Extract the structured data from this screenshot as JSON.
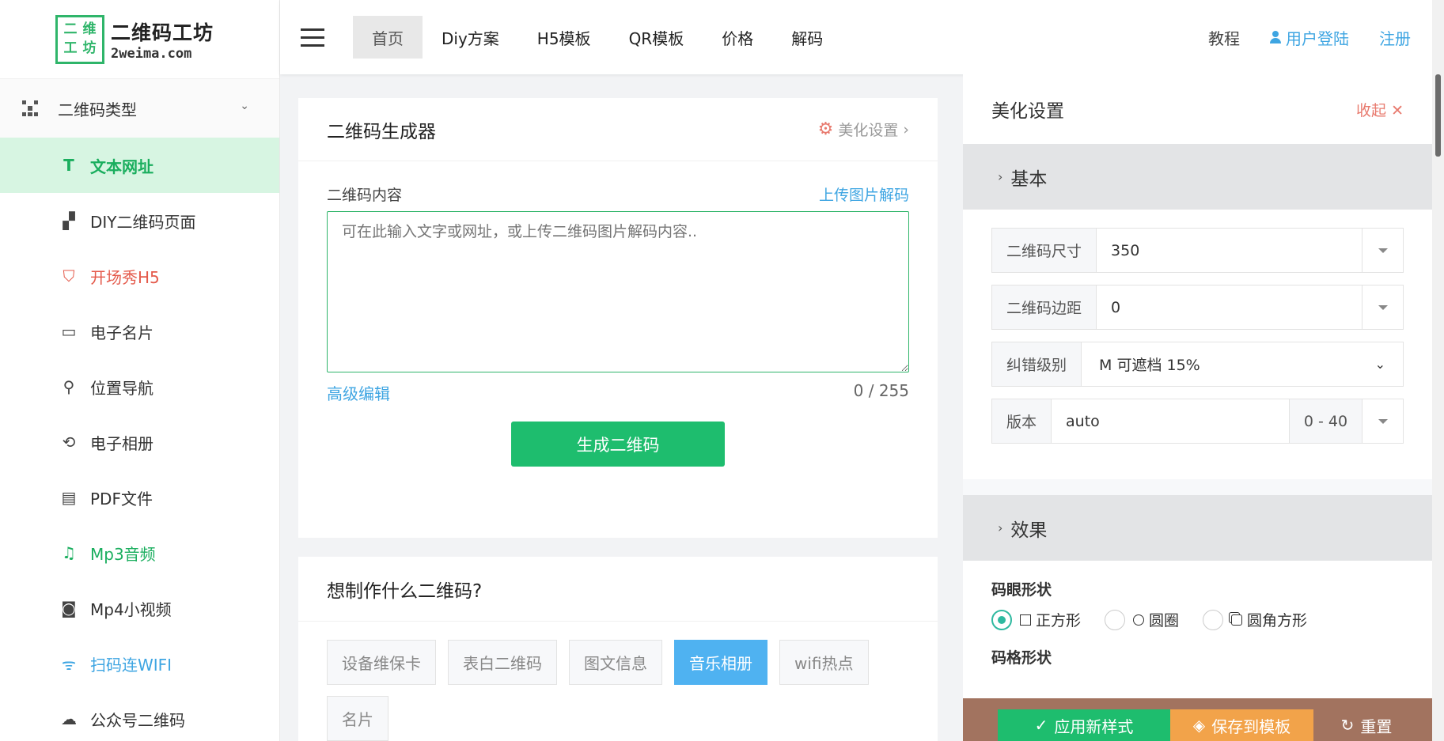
{
  "logo": {
    "cn": "二维码工坊",
    "en": "2weima.com",
    "box_chars": [
      "二",
      "维",
      "工",
      "坊"
    ]
  },
  "sidebar": {
    "group_label": "二维码类型",
    "items": [
      {
        "label": "文本网址",
        "icon": "text-icon",
        "glyph": "T"
      },
      {
        "label": "DIY二维码页面",
        "icon": "layout-icon",
        "glyph": "▞"
      },
      {
        "label": "开场秀H5",
        "icon": "html5-icon",
        "glyph": "⛉"
      },
      {
        "label": "电子名片",
        "icon": "id-card-icon",
        "glyph": "▭"
      },
      {
        "label": "位置导航",
        "icon": "location-icon",
        "glyph": "⚲"
      },
      {
        "label": "电子相册",
        "icon": "refresh-icon",
        "glyph": "⟲"
      },
      {
        "label": "PDF文件",
        "icon": "pdf-icon",
        "glyph": "▤"
      },
      {
        "label": "Mp3音频",
        "icon": "music-icon",
        "glyph": "♫"
      },
      {
        "label": "Mp4小视频",
        "icon": "camera-icon",
        "glyph": "◙"
      },
      {
        "label": "扫码连WIFI",
        "icon": "wifi-icon",
        "glyph": "ᯤ"
      },
      {
        "label": "公众号二维码",
        "icon": "wechat-icon",
        "glyph": "☁"
      }
    ]
  },
  "topnav": {
    "items": [
      "首页",
      "Diy方案",
      "H5模板",
      "QR模板",
      "价格",
      "解码"
    ],
    "tutorial": "教程",
    "login": "用户登陆",
    "register": "注册"
  },
  "generator": {
    "title": "二维码生成器",
    "beautify_link": "美化设置",
    "content_label": "二维码内容",
    "upload_link": "上传图片解码",
    "placeholder": "可在此输入文字或网址，或上传二维码图片解码内容..",
    "advanced": "高级编辑",
    "count": "0 / 255",
    "button": "生成二维码"
  },
  "want": {
    "title": "想制作什么二维码?",
    "tags": [
      "设备维保卡",
      "表白二维码",
      "图文信息",
      "音乐相册",
      "wifi热点",
      "名片"
    ],
    "selected_tag": "音乐相册"
  },
  "panel": {
    "title": "美化设置",
    "collapse": "收起 ✕",
    "basic_section": "基本",
    "size_label": "二维码尺寸",
    "size_value": "350",
    "margin_label": "二维码边距",
    "margin_value": "0",
    "ecc_label": "纠错级别",
    "ecc_value": "M 可遮档 15%",
    "version_label": "版本",
    "version_value": "auto",
    "version_range": "0 - 40",
    "effect_section": "效果",
    "eye_shape_title": "码眼形状",
    "eye_options": [
      "正方形",
      "圆圈",
      "圆角方形"
    ],
    "grid_shape_title": "码格形状"
  },
  "actions": {
    "apply": "应用新样式",
    "save": "保存到模板",
    "reset": "重置"
  },
  "colors": {
    "accent_green": "#1ebd6e",
    "link_blue": "#3ea5e2",
    "tag_selected": "#4fb2f1",
    "save_orange": "#f2a34a",
    "danger": "#e87a6e"
  }
}
